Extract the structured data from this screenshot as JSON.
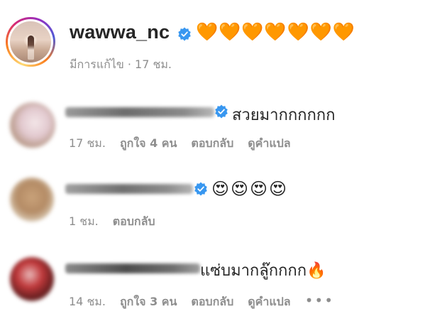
{
  "post": {
    "username": "wawwa_nc",
    "caption_emojis": "🧡🧡🧡🧡🧡🧡🧡",
    "edited_label": "มีการแก้ไข · 17 ชม."
  },
  "comments": [
    {
      "text": "สวยมากกกกกก",
      "time": "17 ชม.",
      "likes": "ถูกใจ 4 คน",
      "reply": "ตอบกลับ",
      "translate": "ดูคำแปล"
    },
    {
      "text": "😍😍😍😍",
      "time": "1 ชม.",
      "reply": "ตอบกลับ"
    },
    {
      "text": "แซ่บมากลู๊กกกก🔥",
      "time": "14 ชม.",
      "likes": "ถูกใจ 3 คน",
      "reply": "ตอบกลับ",
      "translate": "ดูคำแปล",
      "more": "•••"
    }
  ],
  "colors": {
    "verified": "#3897f0",
    "meta_text": "#8e8e8e",
    "primary_text": "#262626"
  },
  "icons": {
    "verified": "verified-badge-icon",
    "more": "more-options-icon"
  }
}
